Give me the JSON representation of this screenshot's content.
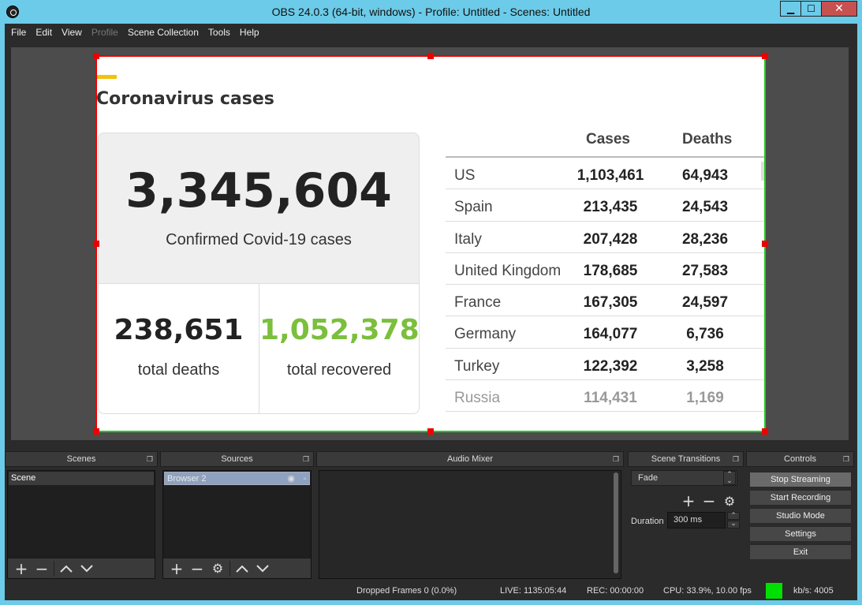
{
  "window": {
    "title": "OBS 24.0.3 (64-bit, windows) - Profile: Untitled - Scenes: Untitled",
    "minimize": "▁",
    "maximize": "☐",
    "close": "✕"
  },
  "menu": [
    "File",
    "Edit",
    "View",
    "Profile",
    "Scene Collection",
    "Tools",
    "Help"
  ],
  "preview": {
    "title": "Coronavirus cases",
    "confirmed_value": "3,345,604",
    "confirmed_label": "Confirmed Covid-19 cases",
    "deaths_value": "238,651",
    "deaths_label": "total deaths",
    "recovered_value": "1,052,378",
    "recovered_label": "total recovered",
    "table": {
      "headers": [
        "Cases",
        "Deaths"
      ],
      "rows": [
        {
          "country": "US",
          "cases": "1,103,461",
          "deaths": "64,943"
        },
        {
          "country": "Spain",
          "cases": "213,435",
          "deaths": "24,543"
        },
        {
          "country": "Italy",
          "cases": "207,428",
          "deaths": "28,236"
        },
        {
          "country": "United Kingdom",
          "cases": "178,685",
          "deaths": "27,583"
        },
        {
          "country": "France",
          "cases": "167,305",
          "deaths": "24,597"
        },
        {
          "country": "Germany",
          "cases": "164,077",
          "deaths": "6,736"
        },
        {
          "country": "Turkey",
          "cases": "122,392",
          "deaths": "3,258"
        },
        {
          "country": "Russia",
          "cases": "114,431",
          "deaths": "1,169"
        }
      ]
    }
  },
  "docks": {
    "scenes": {
      "title": "Scenes",
      "items": [
        "Scene"
      ]
    },
    "sources": {
      "title": "Sources",
      "items": [
        "Browser 2"
      ]
    },
    "mixer": {
      "title": "Audio Mixer"
    },
    "transitions": {
      "title": "Scene Transitions",
      "selected": "Fade",
      "duration_label": "Duration",
      "duration_value": "300 ms"
    },
    "controls": {
      "title": "Controls",
      "buttons": [
        "Stop Streaming",
        "Start Recording",
        "Studio Mode",
        "Settings",
        "Exit"
      ]
    }
  },
  "status": {
    "dropped": "Dropped Frames 0 (0.0%)",
    "live": "LIVE: 1135:05:44",
    "rec": "REC: 00:00:00",
    "cpu": "CPU: 33.9%, 10.00 fps",
    "kbps": "kb/s: 4005",
    "stream_color": "#00e000"
  }
}
